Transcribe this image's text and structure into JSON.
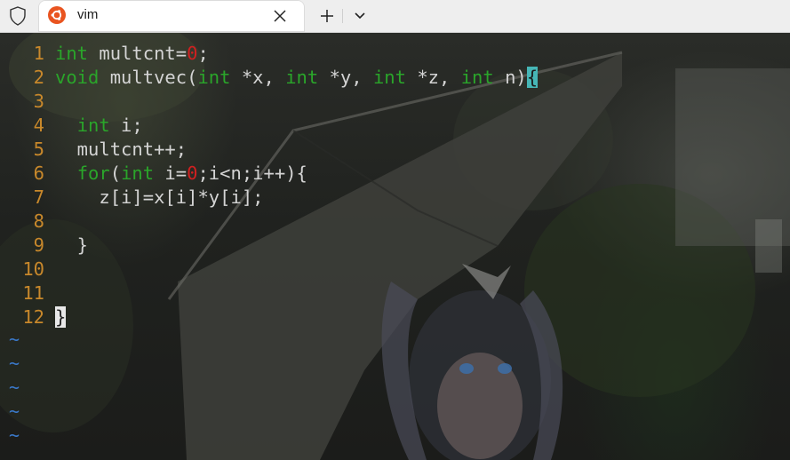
{
  "tab": {
    "title": "vim",
    "icon": "ubuntu-icon",
    "accent": "#e95420"
  },
  "toolbar": {
    "shield_icon": "shield-icon",
    "close_icon": "close-icon",
    "new_tab_icon": "plus-icon",
    "dropdown_icon": "chevron-down-icon"
  },
  "colors": {
    "keyword": "#2aa52a",
    "number": "#d02020",
    "line_number": "#c8882b",
    "tilde": "#3a78c8",
    "match_highlight": "#46b6b6"
  },
  "editor": {
    "lines": [
      {
        "num": "1",
        "tokens": [
          [
            "kw",
            "int"
          ],
          [
            "t",
            " multcnt="
          ],
          [
            "num",
            "0"
          ],
          [
            "t",
            ";"
          ]
        ]
      },
      {
        "num": "2",
        "tokens": [
          [
            "kw",
            "void"
          ],
          [
            "t",
            " multvec("
          ],
          [
            "kw",
            "int"
          ],
          [
            "t",
            " *x, "
          ],
          [
            "kw",
            "int"
          ],
          [
            "t",
            " *y, "
          ],
          [
            "kw",
            "int"
          ],
          [
            "t",
            " *z, "
          ],
          [
            "kw",
            "int"
          ],
          [
            "t",
            " n)"
          ],
          [
            "match",
            "{"
          ]
        ]
      },
      {
        "num": "3",
        "tokens": []
      },
      {
        "num": "4",
        "tokens": [
          [
            "t",
            "  "
          ],
          [
            "kw",
            "int"
          ],
          [
            "t",
            " i;"
          ]
        ]
      },
      {
        "num": "5",
        "tokens": [
          [
            "t",
            "  multcnt++;"
          ]
        ]
      },
      {
        "num": "6",
        "tokens": [
          [
            "t",
            "  "
          ],
          [
            "kw",
            "for"
          ],
          [
            "t",
            "("
          ],
          [
            "kw",
            "int"
          ],
          [
            "t",
            " i="
          ],
          [
            "num",
            "0"
          ],
          [
            "t",
            ";i<n;i++){"
          ]
        ]
      },
      {
        "num": "7",
        "tokens": [
          [
            "t",
            "    z[i]=x[i]*y[i];"
          ]
        ]
      },
      {
        "num": "8",
        "tokens": []
      },
      {
        "num": "9",
        "tokens": [
          [
            "t",
            "  }"
          ]
        ]
      },
      {
        "num": "10",
        "tokens": []
      },
      {
        "num": "11",
        "tokens": []
      },
      {
        "num": "12",
        "tokens": [
          [
            "cursor",
            "}"
          ]
        ]
      }
    ],
    "tildes": [
      "~",
      "~",
      "~",
      "~",
      "~"
    ]
  }
}
